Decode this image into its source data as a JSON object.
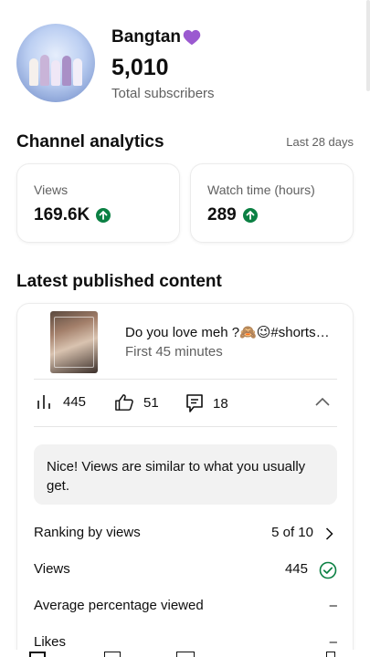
{
  "channel": {
    "name": "Bangtan",
    "name_emoji": "purple-heart",
    "subscribers": "5,010",
    "subscribers_label": "Total subscribers"
  },
  "analytics": {
    "title": "Channel analytics",
    "range": "Last 28 days",
    "metrics": [
      {
        "label": "Views",
        "value": "169.6K",
        "trend": "up"
      },
      {
        "label": "Watch time (hours)",
        "value": "289",
        "trend": "up"
      }
    ]
  },
  "latest": {
    "title": "Latest published content",
    "video": {
      "title": "Do you love meh ?🙈😉#shorts…",
      "subtitle": "First 45 minutes",
      "views": "445",
      "likes": "51",
      "comments": "18"
    },
    "notice": "Nice! Views are similar to what you usually get.",
    "rows": [
      {
        "label": "Ranking by views",
        "value": "5 of 10",
        "end": "chevron-right-icon"
      },
      {
        "label": "Views",
        "value": "445",
        "end": "check-circle-icon"
      },
      {
        "label": "Average percentage viewed",
        "value": "",
        "end": "–"
      },
      {
        "label": "Likes",
        "value": "",
        "end": "–"
      }
    ]
  },
  "colors": {
    "accent_green": "#0b8043",
    "text_secondary": "#606060",
    "notice_bg": "#f2f2f2"
  }
}
